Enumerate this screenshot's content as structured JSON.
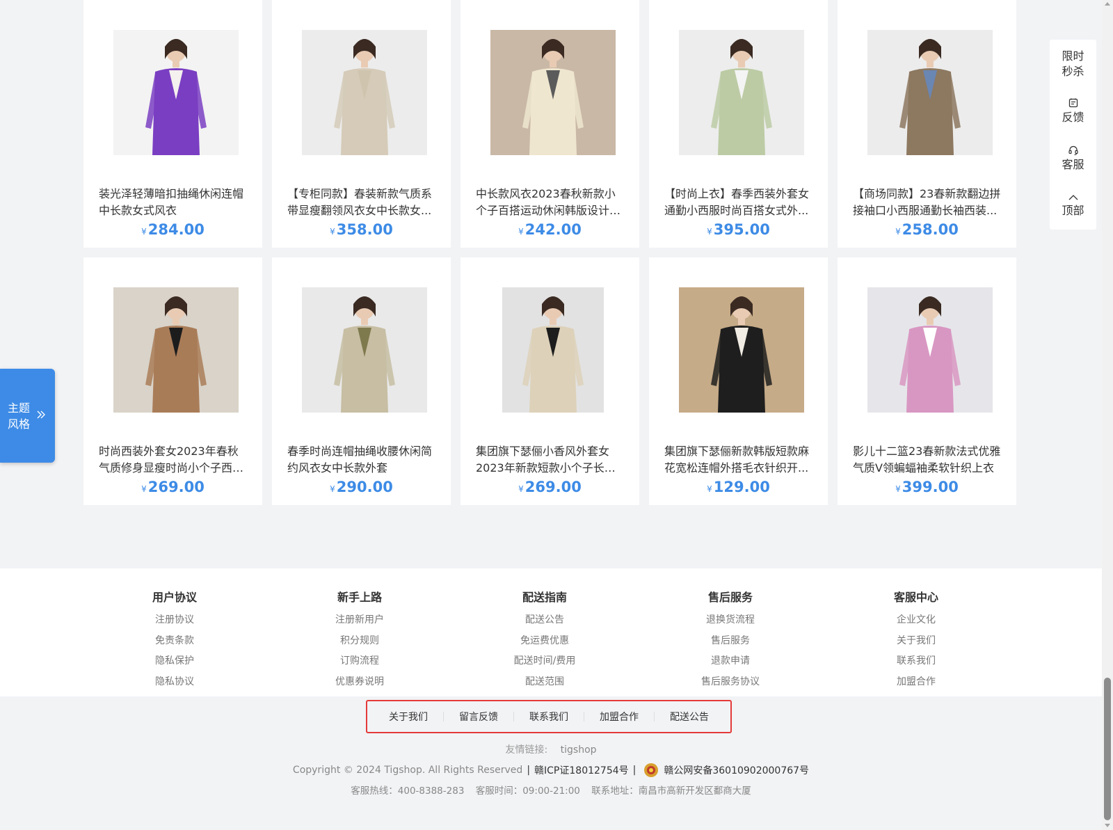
{
  "products": [
    {
      "title": "装光泽轻薄暗扣抽绳休闲连帽中长款女式风衣",
      "currency": "¥",
      "price": "284.00",
      "image": "purple-trench-coat",
      "bg": "#f3f3f3",
      "garment": "#7a3ec2",
      "inner": "#f5f1ee"
    },
    {
      "title": "【专柜同款】春装新款气质系带显瘦翻领风衣女中长款女...",
      "currency": "¥",
      "price": "358.00",
      "image": "beige-trench-coat",
      "bg": "#ececec",
      "garment": "#d5cbb8",
      "inner": "#cfc4ae"
    },
    {
      "title": "中长款风衣2023春秋新款小个子百搭运动休闲韩版设计感...",
      "currency": "¥",
      "price": "242.00",
      "image": "cream-jacket",
      "bg": "#c9b8a6",
      "garment": "#efe6cf",
      "inner": "#5b5b5b"
    },
    {
      "title": "【时尚上衣】春季西装外套女通勤小西服时尚百搭女式外...",
      "currency": "¥",
      "price": "395.00",
      "image": "green-blazer",
      "bg": "#ededed",
      "garment": "#bccba4",
      "inner": "#f4f4f4"
    },
    {
      "title": "【商场同款】23春新款翻边拼接袖口小西服通勤长袖西装...",
      "currency": "¥",
      "price": "258.00",
      "image": "brown-blazer",
      "bg": "#ececec",
      "garment": "#8d7860",
      "inner": "#6a86b2"
    },
    {
      "title": "时尚西装外套女2023年春秋气质修身显瘦时尚小个子西服...",
      "currency": "¥",
      "price": "269.00",
      "image": "camel-blazer",
      "bg": "#d9d3c9",
      "garment": "#a97c58",
      "inner": "#1c1c1c"
    },
    {
      "title": "春季时尚连帽抽绳收腰休闲简约风衣女中长款外套",
      "currency": "¥",
      "price": "290.00",
      "image": "khaki-hooded-coat",
      "bg": "#e9e9e9",
      "garment": "#c7bea3",
      "inner": "#7f7a4e"
    },
    {
      "title": "集团旗下瑟俪小香风外套女2023年新款短款小个子长袖开...",
      "currency": "¥",
      "price": "269.00",
      "image": "tweed-jacket",
      "bg": "#e2e2e2",
      "garment": "#ddd1b9",
      "inner": "#1d1d1d"
    },
    {
      "title": "集团旗下瑟俪新款韩版短款麻花宽松连帽外搭毛衣针织开...",
      "currency": "¥",
      "price": "129.00",
      "image": "black-cardigan",
      "bg": "#c6ab88",
      "garment": "#1e1e1e",
      "inner": "#f0ebe3"
    },
    {
      "title": "影儿十二篮23春新款法式优雅气质V领蝙蝠袖柔软针织上衣",
      "currency": "¥",
      "price": "399.00",
      "image": "pink-cardigan",
      "bg": "#e6e6ea",
      "garment": "#d897c2",
      "inner": "#ffffff"
    }
  ],
  "footer": {
    "columns": [
      {
        "heading": "用户协议",
        "items": [
          "注册协议",
          "免责条款",
          "隐私保护",
          "隐私协议"
        ]
      },
      {
        "heading": "新手上路",
        "items": [
          "注册新用户",
          "积分规则",
          "订购流程",
          "优惠券说明"
        ]
      },
      {
        "heading": "配送指南",
        "items": [
          "配送公告",
          "免运费优惠",
          "配送时间/费用",
          "配送范围"
        ]
      },
      {
        "heading": "售后服务",
        "items": [
          "退换货流程",
          "售后服务",
          "退款申请",
          "售后服务协议"
        ]
      },
      {
        "heading": "客服中心",
        "items": [
          "企业文化",
          "关于我们",
          "联系我们",
          "加盟合作"
        ]
      }
    ],
    "nav": [
      "关于我们",
      "留言反馈",
      "联系我们",
      "加盟合作",
      "配送公告"
    ],
    "friend_label": "友情链接:",
    "friend_link": "tigshop",
    "copyright": "Copyright © 2024 Tigshop. All Rights Reserved",
    "icp": "赣ICP证18012754号",
    "police": "赣公网安备36010902000767号",
    "hotline": "客服热线：400-8388-283",
    "service_time": "客服时间：09:00-21:00",
    "address": "联系地址：南昌市高新开发区鄱商大厦"
  },
  "sidebar": {
    "flash_sale": "限时秒杀",
    "feedback": "反馈",
    "service": "客服",
    "top": "顶部"
  },
  "theme_tab": {
    "line1": "主题",
    "line2": "风格"
  },
  "colors": {
    "accent": "#3d8be6",
    "highlight_border": "#e43a3a"
  }
}
